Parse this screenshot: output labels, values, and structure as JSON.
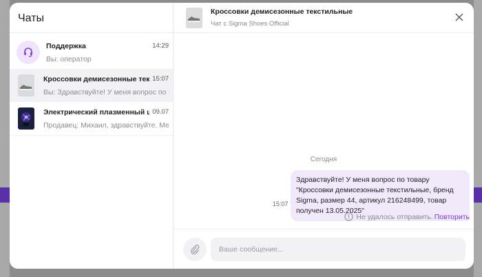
{
  "sidebar": {
    "title": "Чаты",
    "chats": [
      {
        "name": "Поддержка",
        "time": "14:29",
        "preview": "Вы: оператор",
        "avatar_icon": "headset-icon"
      },
      {
        "name": "Кроссовки демисезонные текстильные",
        "time": "15:07",
        "preview": "Вы: Здравствуйте! У меня вопрос по товару",
        "avatar_icon": "sneakers-thumbnail"
      },
      {
        "name": "Электрический плазменный шар",
        "time": "09.07",
        "preview": "Продавец: Михаил, здравствуйте. Меня",
        "avatar_icon": "plasma-ball-thumbnail"
      }
    ]
  },
  "conversation": {
    "title": "Кроссовки демисезонные текстильные",
    "subtitle": "Чат с Sigma Shoes Official",
    "date_separator": "Сегодня",
    "message": {
      "text": "Здравствуйте! У меня вопрос по товару \"Кроссовки демисезонные текстильные, бренд Sigma, размер 44, артикул 216248499, товар получен 13.05.2025\"",
      "time": "15:07"
    },
    "error_text": "Не удалось отправить.",
    "retry_label": "Повторить"
  },
  "composer": {
    "placeholder": "Ваше сообщение..."
  },
  "colors": {
    "accent": "#7a35d9",
    "bubble": "#f0e9fa",
    "active_row": "#f2f2f5"
  }
}
